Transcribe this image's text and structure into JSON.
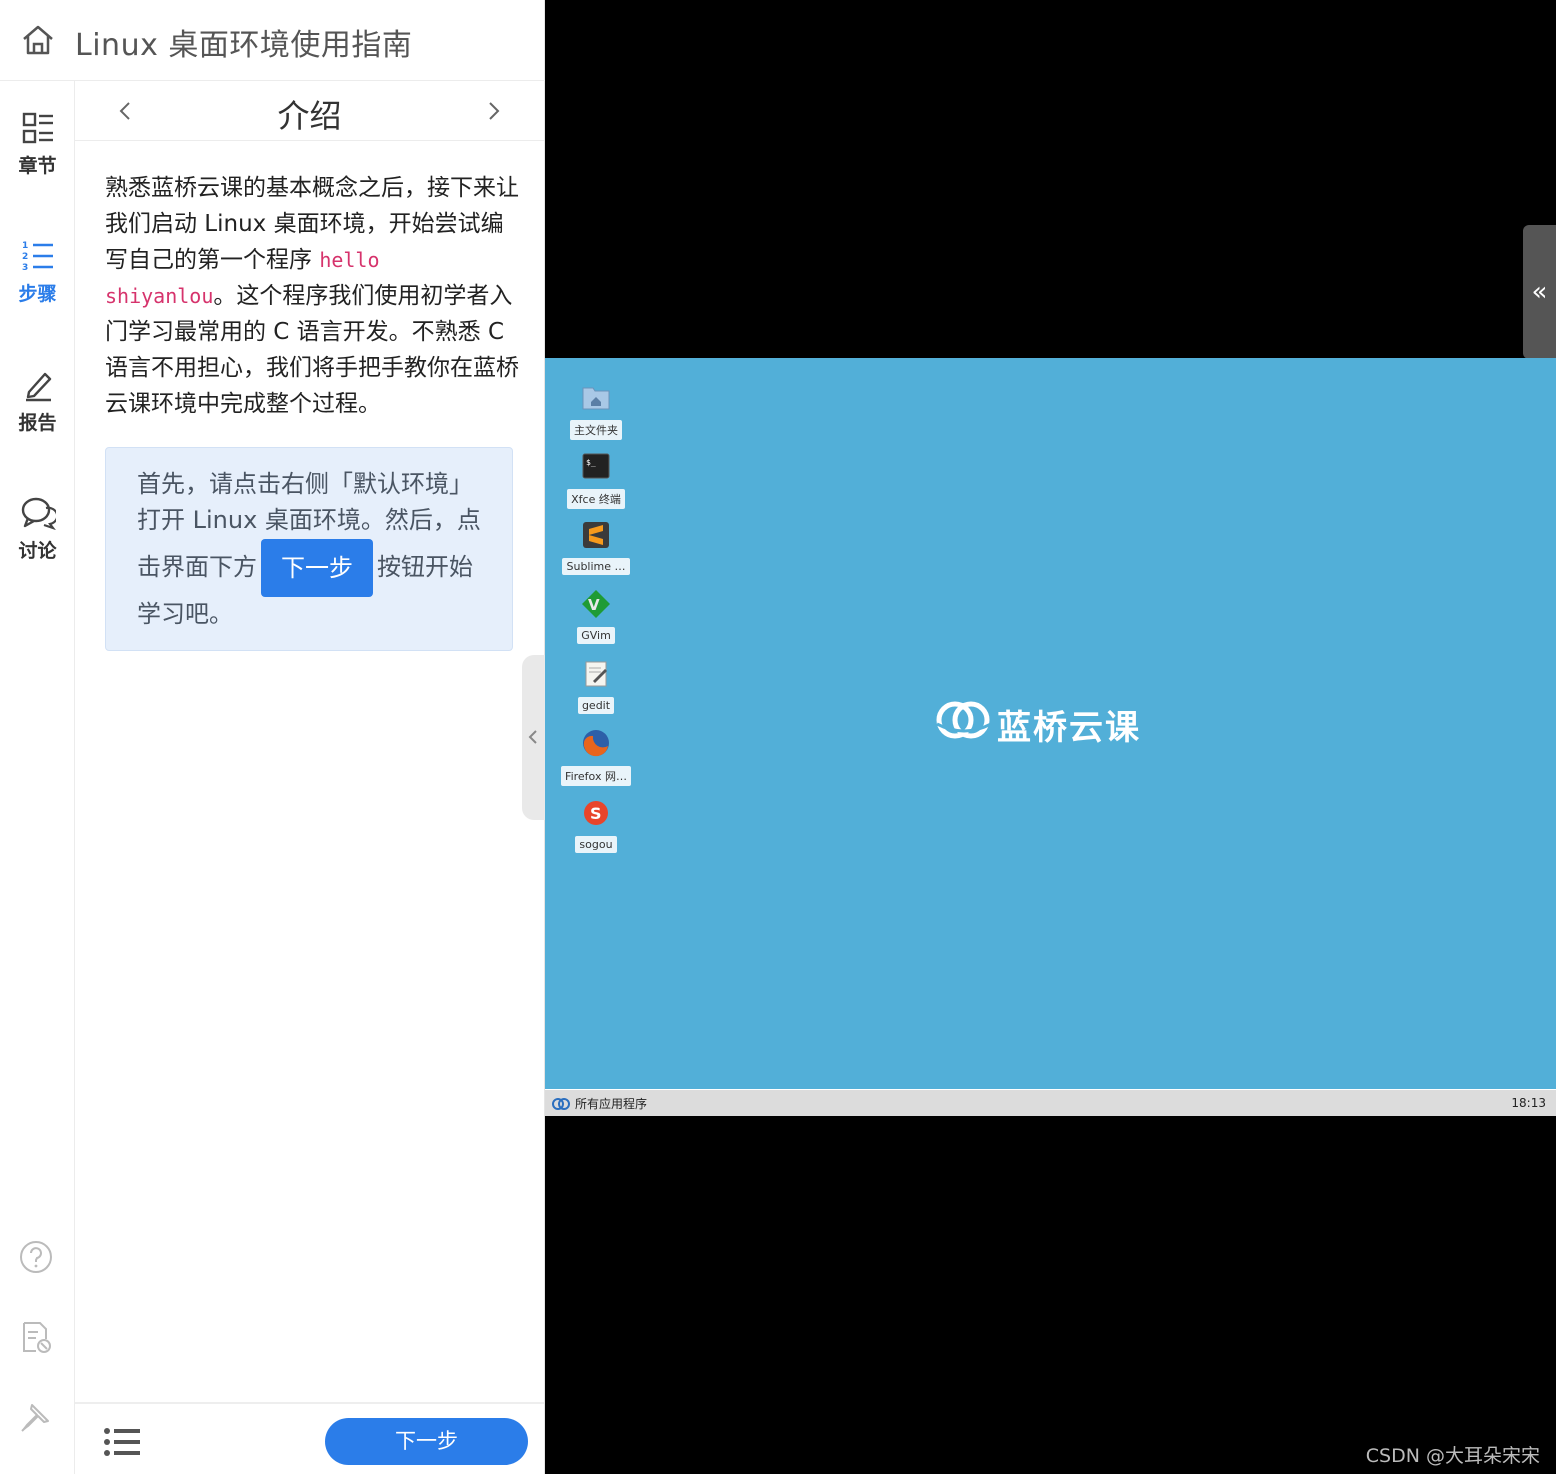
{
  "header": {
    "course_title": "Linux 桌面环境使用指南"
  },
  "sidenav": {
    "items": [
      {
        "label": "章节",
        "icon": "chapters-icon"
      },
      {
        "label": "步骤",
        "icon": "steps-icon"
      },
      {
        "label": "报告",
        "icon": "pencil-icon"
      },
      {
        "label": "讨论",
        "icon": "chat-icon"
      }
    ],
    "active": "步骤",
    "bottom_icons": [
      "help-icon",
      "document-settings-icon",
      "pin-icon"
    ]
  },
  "step": {
    "title": "介绍",
    "paragraph": {
      "before_code": "熟悉蓝桥云课的基本概念之后，接下来让我们启动 Linux 桌面环境，开始尝试编写自己的第一个程序 ",
      "code": "hello shiyanlou",
      "after_code": "。这个程序我们使用初学者入门学习最常用的 C 语言开发。不熟悉 C 语言不用担心，我们将手把手教你在蓝桥云课环境中完成整个过程。"
    },
    "tip": {
      "line1": "首先，请点击右侧「默认环境」",
      "line2": "打开 Linux 桌面环境。然后，点",
      "line3_before": "击界面下方",
      "button": "下一步",
      "line3_after": "按钮开始",
      "line4": "学习吧。"
    }
  },
  "footer": {
    "next_button": "下一步"
  },
  "vm": {
    "collapse_symbol": "«",
    "desktop_icons": [
      {
        "label": "主文件夹",
        "icon": "home-folder-icon"
      },
      {
        "label": "Xfce 终端",
        "icon": "terminal-icon"
      },
      {
        "label": "Sublime …",
        "icon": "sublime-icon"
      },
      {
        "label": "GVim",
        "icon": "vim-icon"
      },
      {
        "label": "gedit",
        "icon": "gedit-icon"
      },
      {
        "label": "Firefox 网…",
        "icon": "firefox-icon"
      },
      {
        "label": "sogou",
        "icon": "sogou-icon"
      }
    ],
    "brand": "蓝桥云课",
    "taskbar": {
      "apps_label": "所有应用程序",
      "clock": "18:13"
    },
    "colors": {
      "desktop": "#52afd8",
      "accent": "#2b7de9"
    }
  },
  "watermark": "CSDN @大耳朵宋宋"
}
